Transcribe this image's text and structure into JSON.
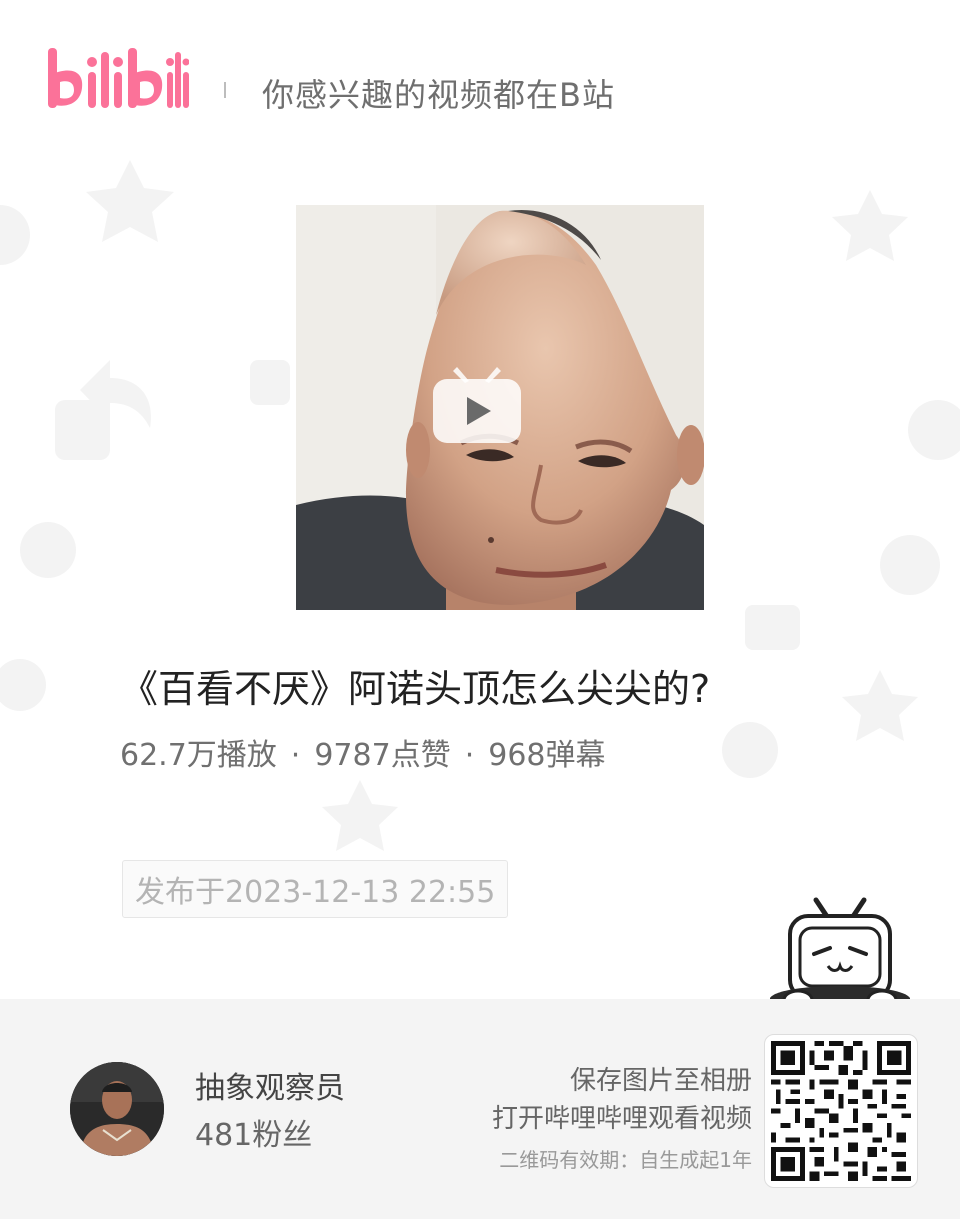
{
  "header": {
    "logo_text": "bilibili",
    "slogan": "你感兴趣的视频都在B站"
  },
  "video": {
    "title": "《百看不厌》阿诺头顶怎么尖尖的?",
    "plays": "62.7万播放",
    "likes": "9787点赞",
    "danmaku": "968弹幕",
    "separator": "·",
    "publish_date": "发布于2023-12-13 22:55"
  },
  "author": {
    "name": "抽象观察员",
    "fans": "481粉丝"
  },
  "share": {
    "save_hint": "保存图片至相册",
    "open_hint": "打开哔哩哔哩观看视频",
    "validity": "二维码有效期：自生成起1年"
  },
  "colors": {
    "brand_pink": "#fb7299",
    "footer_bg": "#f4f4f4"
  }
}
